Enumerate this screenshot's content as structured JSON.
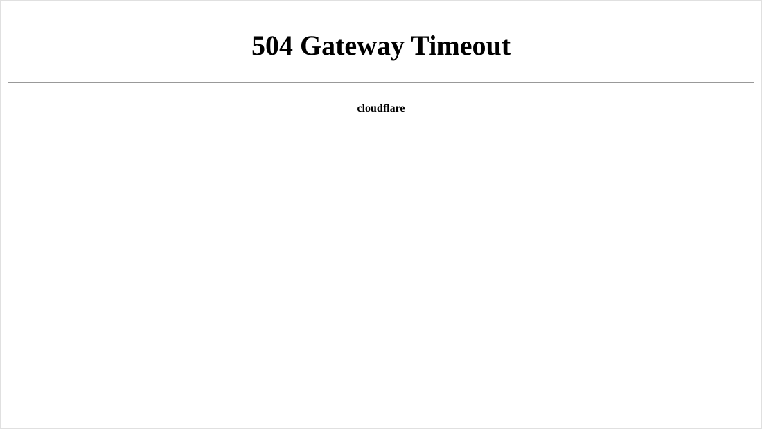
{
  "error": {
    "title": "504 Gateway Timeout",
    "provider": "cloudflare"
  }
}
